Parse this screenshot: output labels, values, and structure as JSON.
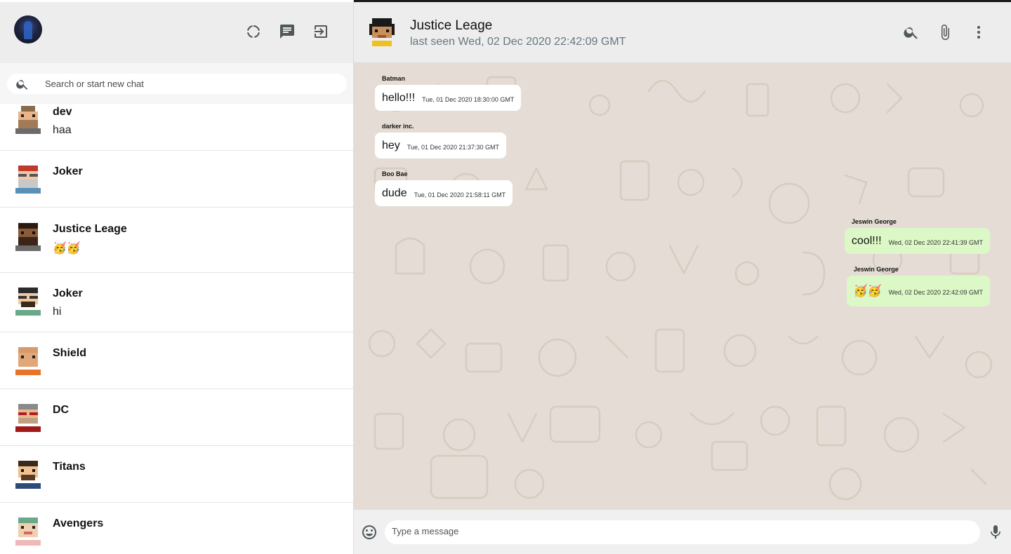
{
  "sidebar": {
    "header": {
      "icons": [
        "status-icon",
        "new-chat-icon",
        "logout-icon"
      ]
    },
    "search": {
      "placeholder": "Search or start new chat"
    },
    "chats": [
      {
        "name": "dev",
        "last_message": "haa"
      },
      {
        "name": "Joker",
        "last_message": ""
      },
      {
        "name": "Justice Leage",
        "last_message": "🥳🥳"
      },
      {
        "name": "Joker",
        "last_message": "hi"
      },
      {
        "name": "Shield",
        "last_message": ""
      },
      {
        "name": "DC",
        "last_message": ""
      },
      {
        "name": "Titans",
        "last_message": ""
      },
      {
        "name": "Avengers",
        "last_message": ""
      }
    ]
  },
  "chat": {
    "title": "Justice Leage",
    "subtitle": "last seen Wed, 02 Dec 2020 22:42:09 GMT",
    "icons": [
      "search-icon",
      "attach-icon",
      "more-icon"
    ],
    "messages": [
      {
        "sender": "Batman",
        "text": "hello!!!",
        "time": "Tue, 01 Dec 2020 18:30:00 GMT",
        "outgoing": false
      },
      {
        "sender": "darker inc.",
        "text": "hey",
        "time": "Tue, 01 Dec 2020 21:37:30 GMT",
        "outgoing": false
      },
      {
        "sender": "Boo Bae",
        "text": "dude",
        "time": "Tue, 01 Dec 2020 21:58:11 GMT",
        "outgoing": false
      },
      {
        "sender": "Jeswin George",
        "text": "cool!!!",
        "time": "Wed, 02 Dec 2020 22:41:39 GMT",
        "outgoing": true
      },
      {
        "sender": "Jeswin George",
        "text": "🥳🥳",
        "time": "Wed, 02 Dec 2020 22:42:09 GMT",
        "outgoing": true
      }
    ]
  },
  "composer": {
    "placeholder": "Type a message",
    "icons": [
      "emoji-icon",
      "microphone-icon"
    ]
  },
  "colors": {
    "header_bg": "#ededed",
    "chat_bg": "#e5ddd5",
    "outgoing_bubble": "#dcf8c6",
    "incoming_bubble": "#ffffff",
    "icon": "#51585c"
  }
}
